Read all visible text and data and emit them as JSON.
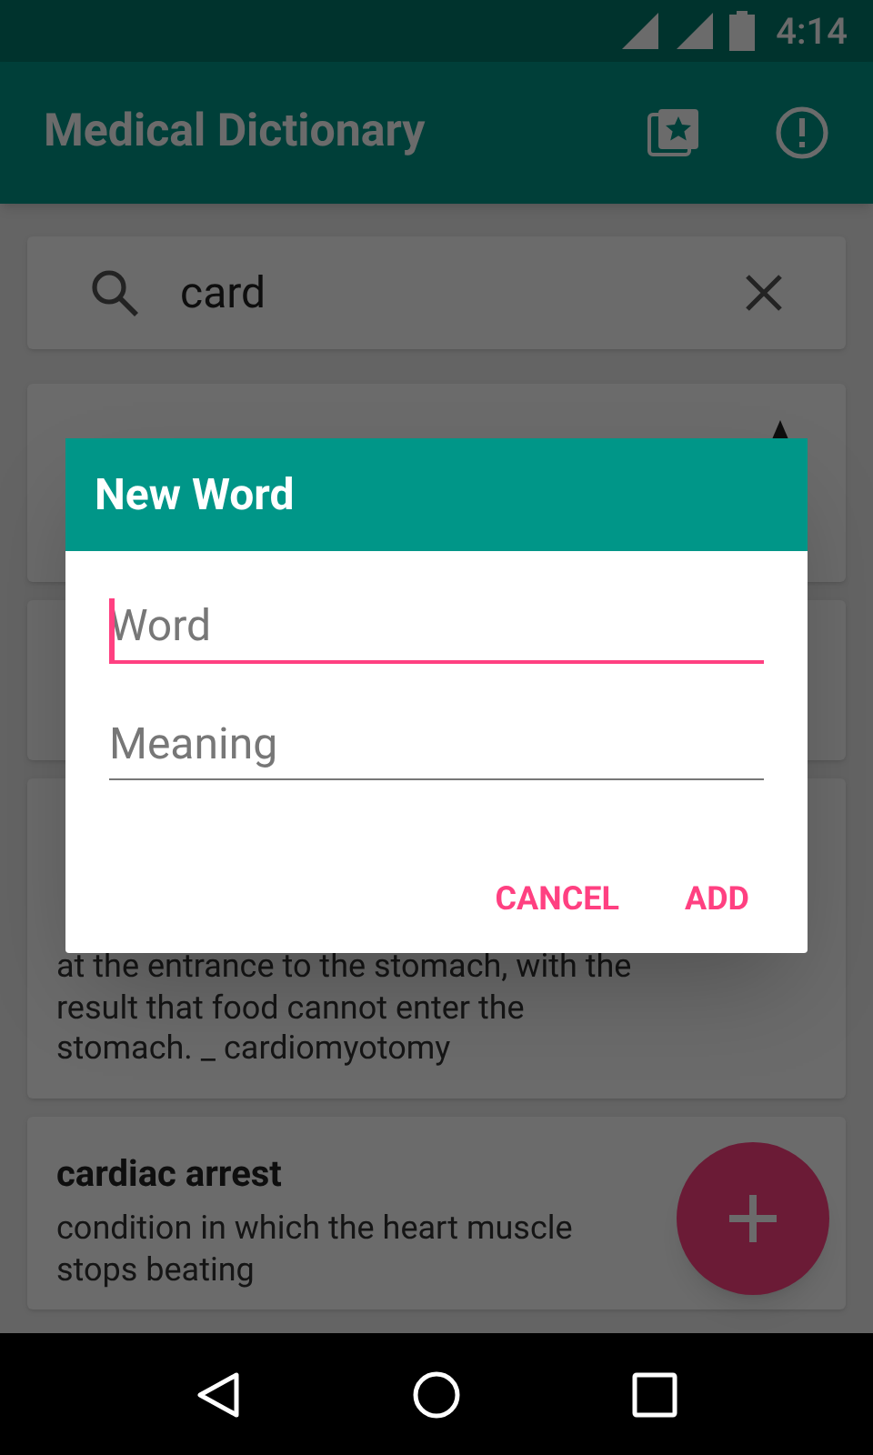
{
  "status_bar": {
    "time": "4:14"
  },
  "app_bar": {
    "title": "Medical Dictionary"
  },
  "search": {
    "value": "card"
  },
  "entries": [
    {
      "kind": "covered"
    },
    {
      "kind": "hidden"
    },
    {
      "kind": "tail",
      "definition": "at the entrance to the stomach, with the result that food cannot enter the stomach. _ cardiomyotomy"
    },
    {
      "kind": "full",
      "term": "cardiac arrest",
      "definition": "condition in which the heart muscle stops beating"
    }
  ],
  "dialog": {
    "title": "New Word",
    "fields": [
      {
        "placeholder": "Word",
        "focused": true
      },
      {
        "placeholder": "Meaning",
        "focused": false
      }
    ],
    "buttons": [
      "CANCEL",
      "ADD"
    ]
  }
}
